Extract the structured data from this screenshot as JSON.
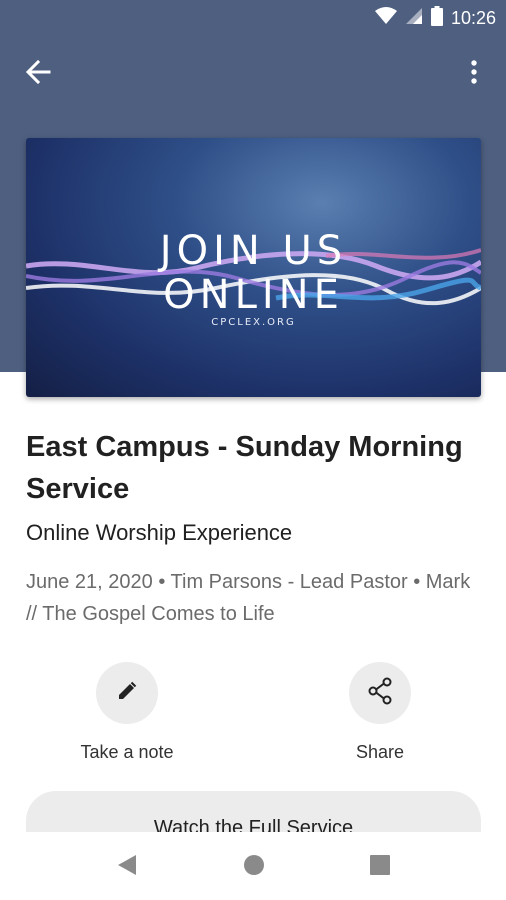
{
  "status_bar": {
    "time": "10:26",
    "icons": [
      "wifi-icon",
      "signal-icon",
      "battery-icon"
    ]
  },
  "app_bar": {
    "back_icon": "arrow-back-icon",
    "menu_icon": "more-vert-icon"
  },
  "banner": {
    "line1": "JOIN US",
    "line2": "ONLINE",
    "url": "CPCLEX.ORG"
  },
  "content": {
    "title": "East Campus - Sunday Morning Service",
    "subtitle": "Online Worship Experience",
    "meta": "June 21, 2020 • Tim Parsons - Lead Pastor • Mark // The Gospel Comes to Life"
  },
  "actions": [
    {
      "label": "Take a note",
      "icon": "pencil-icon"
    },
    {
      "label": "Share",
      "icon": "share-icon"
    }
  ],
  "watch_button": {
    "label": "Watch the Full Service"
  },
  "nav_bar": {
    "icons": [
      "nav-back-icon",
      "nav-home-icon",
      "nav-recent-icon"
    ]
  },
  "colors": {
    "header": "#4e5f80",
    "chip_bg": "#ececec",
    "meta_text": "#6b6b6b"
  }
}
